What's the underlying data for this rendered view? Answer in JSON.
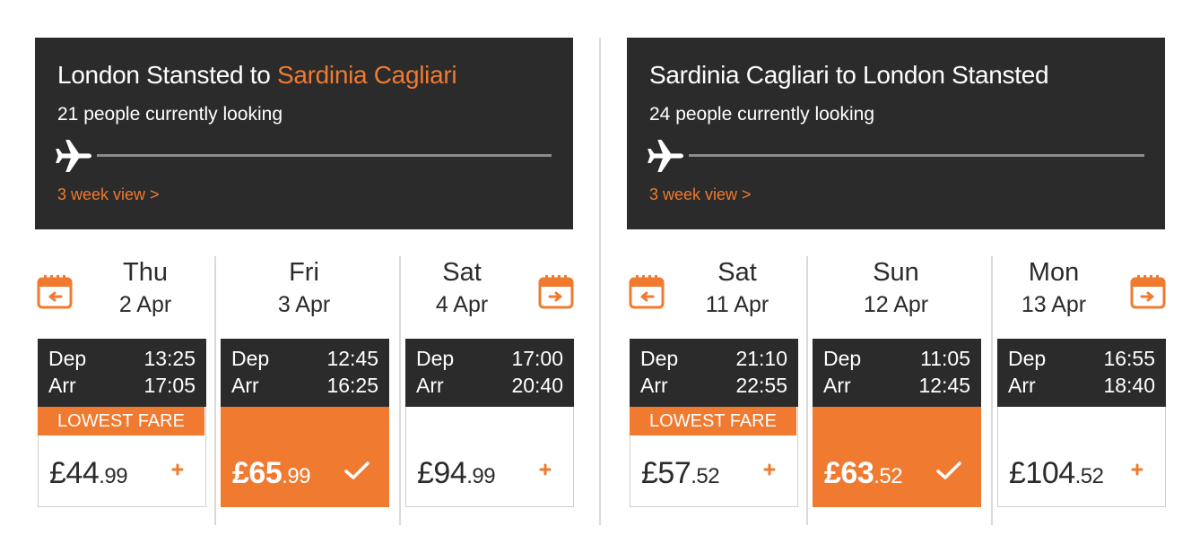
{
  "colors": {
    "accent": "#ef7a30",
    "header_bg": "#2b2b2b",
    "divider": "#d9d9d9"
  },
  "outbound": {
    "route_from": "London Stansted to ",
    "route_to": "Sardinia Cagliari",
    "looking": "21 people currently looking",
    "week_link": "3 week view >",
    "days": [
      {
        "day": "Thu",
        "date": "2 Apr",
        "dep_label": "Dep",
        "dep": "13:25",
        "arr_label": "Arr",
        "arr": "17:05",
        "badge": "LOWEST FARE",
        "pounds": "£44",
        "pence": ".99",
        "selected": false
      },
      {
        "day": "Fri",
        "date": "3 Apr",
        "dep_label": "Dep",
        "dep": "12:45",
        "arr_label": "Arr",
        "arr": "16:25",
        "badge": "",
        "pounds": "£65",
        "pence": ".99",
        "selected": true
      },
      {
        "day": "Sat",
        "date": "4 Apr",
        "dep_label": "Dep",
        "dep": "17:00",
        "arr_label": "Arr",
        "arr": "20:40",
        "badge": "",
        "pounds": "£94",
        "pence": ".99",
        "selected": false
      }
    ]
  },
  "return": {
    "route_from": "Sardinia Cagliari to London Stansted",
    "route_to": "",
    "looking": "24 people currently looking",
    "week_link": "3 week view >",
    "days": [
      {
        "day": "Sat",
        "date": "11 Apr",
        "dep_label": "Dep",
        "dep": "21:10",
        "arr_label": "Arr",
        "arr": "22:55",
        "badge": "LOWEST FARE",
        "pounds": "£57",
        "pence": ".52",
        "selected": false
      },
      {
        "day": "Sun",
        "date": "12 Apr",
        "dep_label": "Dep",
        "dep": "11:05",
        "arr_label": "Arr",
        "arr": "12:45",
        "badge": "",
        "pounds": "£63",
        "pence": ".52",
        "selected": true
      },
      {
        "day": "Mon",
        "date": "13 Apr",
        "dep_label": "Dep",
        "dep": "16:55",
        "arr_label": "Arr",
        "arr": "18:40",
        "badge": "",
        "pounds": "£104",
        "pence": ".52",
        "selected": false
      }
    ]
  },
  "icons": {
    "plane": "plane-icon",
    "prev": "calendar-previous-icon",
    "next": "calendar-next-icon",
    "add": "plus-icon",
    "selected": "checkmark-icon"
  }
}
